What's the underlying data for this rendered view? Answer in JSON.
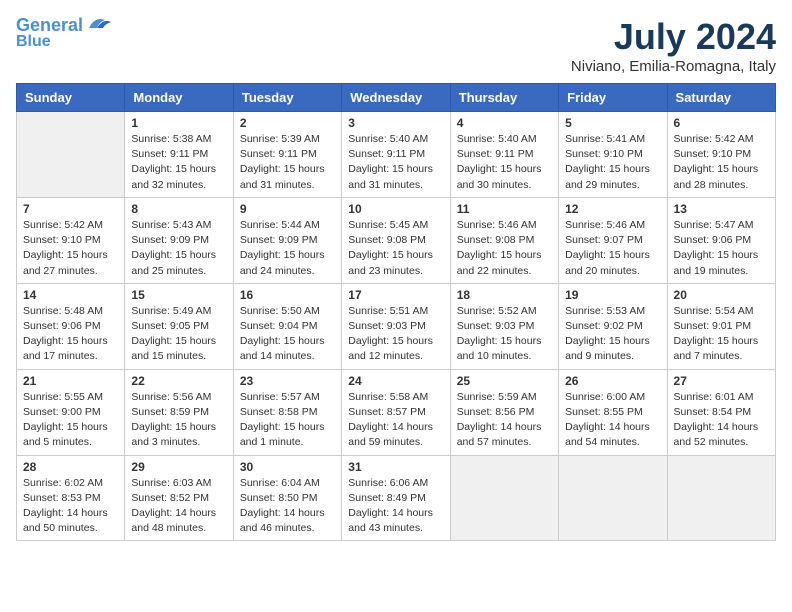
{
  "header": {
    "logo_line1": "General",
    "logo_line2": "Blue",
    "main_title": "July 2024",
    "subtitle": "Niviano, Emilia-Romagna, Italy"
  },
  "weekdays": [
    "Sunday",
    "Monday",
    "Tuesday",
    "Wednesday",
    "Thursday",
    "Friday",
    "Saturday"
  ],
  "weeks": [
    [
      {
        "day": "",
        "info": ""
      },
      {
        "day": "1",
        "info": "Sunrise: 5:38 AM\nSunset: 9:11 PM\nDaylight: 15 hours\nand 32 minutes."
      },
      {
        "day": "2",
        "info": "Sunrise: 5:39 AM\nSunset: 9:11 PM\nDaylight: 15 hours\nand 31 minutes."
      },
      {
        "day": "3",
        "info": "Sunrise: 5:40 AM\nSunset: 9:11 PM\nDaylight: 15 hours\nand 31 minutes."
      },
      {
        "day": "4",
        "info": "Sunrise: 5:40 AM\nSunset: 9:11 PM\nDaylight: 15 hours\nand 30 minutes."
      },
      {
        "day": "5",
        "info": "Sunrise: 5:41 AM\nSunset: 9:10 PM\nDaylight: 15 hours\nand 29 minutes."
      },
      {
        "day": "6",
        "info": "Sunrise: 5:42 AM\nSunset: 9:10 PM\nDaylight: 15 hours\nand 28 minutes."
      }
    ],
    [
      {
        "day": "7",
        "info": "Sunrise: 5:42 AM\nSunset: 9:10 PM\nDaylight: 15 hours\nand 27 minutes."
      },
      {
        "day": "8",
        "info": "Sunrise: 5:43 AM\nSunset: 9:09 PM\nDaylight: 15 hours\nand 25 minutes."
      },
      {
        "day": "9",
        "info": "Sunrise: 5:44 AM\nSunset: 9:09 PM\nDaylight: 15 hours\nand 24 minutes."
      },
      {
        "day": "10",
        "info": "Sunrise: 5:45 AM\nSunset: 9:08 PM\nDaylight: 15 hours\nand 23 minutes."
      },
      {
        "day": "11",
        "info": "Sunrise: 5:46 AM\nSunset: 9:08 PM\nDaylight: 15 hours\nand 22 minutes."
      },
      {
        "day": "12",
        "info": "Sunrise: 5:46 AM\nSunset: 9:07 PM\nDaylight: 15 hours\nand 20 minutes."
      },
      {
        "day": "13",
        "info": "Sunrise: 5:47 AM\nSunset: 9:06 PM\nDaylight: 15 hours\nand 19 minutes."
      }
    ],
    [
      {
        "day": "14",
        "info": "Sunrise: 5:48 AM\nSunset: 9:06 PM\nDaylight: 15 hours\nand 17 minutes."
      },
      {
        "day": "15",
        "info": "Sunrise: 5:49 AM\nSunset: 9:05 PM\nDaylight: 15 hours\nand 15 minutes."
      },
      {
        "day": "16",
        "info": "Sunrise: 5:50 AM\nSunset: 9:04 PM\nDaylight: 15 hours\nand 14 minutes."
      },
      {
        "day": "17",
        "info": "Sunrise: 5:51 AM\nSunset: 9:03 PM\nDaylight: 15 hours\nand 12 minutes."
      },
      {
        "day": "18",
        "info": "Sunrise: 5:52 AM\nSunset: 9:03 PM\nDaylight: 15 hours\nand 10 minutes."
      },
      {
        "day": "19",
        "info": "Sunrise: 5:53 AM\nSunset: 9:02 PM\nDaylight: 15 hours\nand 9 minutes."
      },
      {
        "day": "20",
        "info": "Sunrise: 5:54 AM\nSunset: 9:01 PM\nDaylight: 15 hours\nand 7 minutes."
      }
    ],
    [
      {
        "day": "21",
        "info": "Sunrise: 5:55 AM\nSunset: 9:00 PM\nDaylight: 15 hours\nand 5 minutes."
      },
      {
        "day": "22",
        "info": "Sunrise: 5:56 AM\nSunset: 8:59 PM\nDaylight: 15 hours\nand 3 minutes."
      },
      {
        "day": "23",
        "info": "Sunrise: 5:57 AM\nSunset: 8:58 PM\nDaylight: 15 hours\nand 1 minute."
      },
      {
        "day": "24",
        "info": "Sunrise: 5:58 AM\nSunset: 8:57 PM\nDaylight: 14 hours\nand 59 minutes."
      },
      {
        "day": "25",
        "info": "Sunrise: 5:59 AM\nSunset: 8:56 PM\nDaylight: 14 hours\nand 57 minutes."
      },
      {
        "day": "26",
        "info": "Sunrise: 6:00 AM\nSunset: 8:55 PM\nDaylight: 14 hours\nand 54 minutes."
      },
      {
        "day": "27",
        "info": "Sunrise: 6:01 AM\nSunset: 8:54 PM\nDaylight: 14 hours\nand 52 minutes."
      }
    ],
    [
      {
        "day": "28",
        "info": "Sunrise: 6:02 AM\nSunset: 8:53 PM\nDaylight: 14 hours\nand 50 minutes."
      },
      {
        "day": "29",
        "info": "Sunrise: 6:03 AM\nSunset: 8:52 PM\nDaylight: 14 hours\nand 48 minutes."
      },
      {
        "day": "30",
        "info": "Sunrise: 6:04 AM\nSunset: 8:50 PM\nDaylight: 14 hours\nand 46 minutes."
      },
      {
        "day": "31",
        "info": "Sunrise: 6:06 AM\nSunset: 8:49 PM\nDaylight: 14 hours\nand 43 minutes."
      },
      {
        "day": "",
        "info": ""
      },
      {
        "day": "",
        "info": ""
      },
      {
        "day": "",
        "info": ""
      }
    ]
  ]
}
